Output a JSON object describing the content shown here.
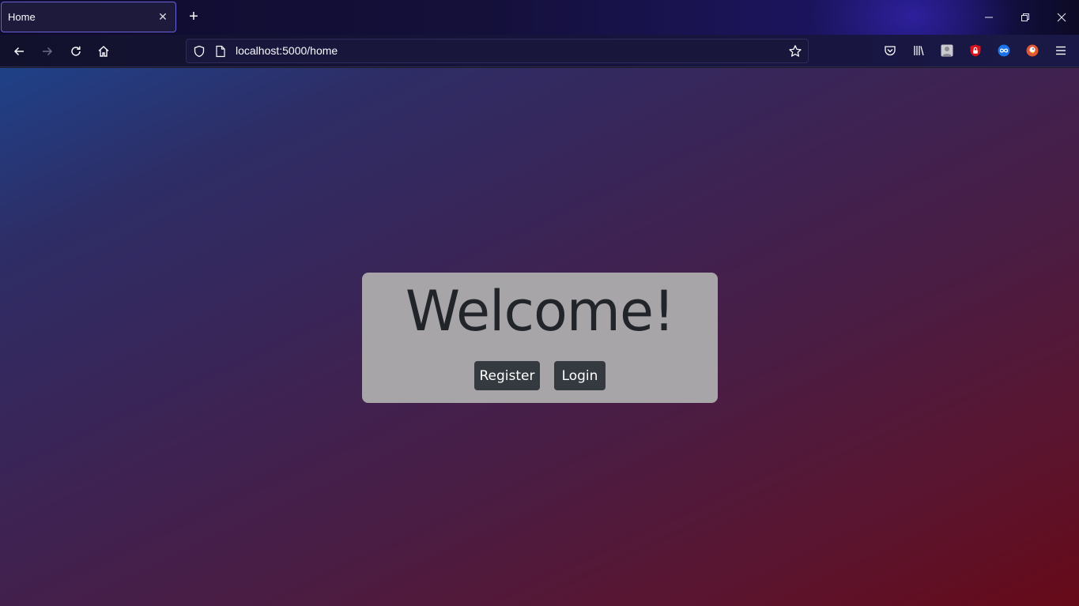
{
  "browser": {
    "tab": {
      "title": "Home",
      "close_glyph": "✕"
    },
    "new_tab_glyph": "+",
    "window_controls": {
      "minimize": "minimize-icon",
      "restore": "restore-icon",
      "close": "close-icon"
    },
    "nav": {
      "back": "back-arrow-icon",
      "forward": "forward-arrow-icon",
      "reload": "reload-icon",
      "home": "home-icon"
    },
    "url": "localhost:5000/home",
    "extensions": [
      "pocket-icon",
      "library-icon",
      "extension-avatar-icon",
      "ublock-icon",
      "infinity-extension-icon",
      "duckduckgo-icon",
      "hamburger-menu-icon"
    ]
  },
  "page": {
    "heading": "Welcome!",
    "buttons": {
      "register": "Register",
      "login": "Login"
    }
  },
  "colors": {
    "card_bg": "#a7a5a7",
    "button_bg": "#343a40",
    "heading_text": "#212529",
    "gradient_start": "#1f4188",
    "gradient_end": "#660a18"
  }
}
